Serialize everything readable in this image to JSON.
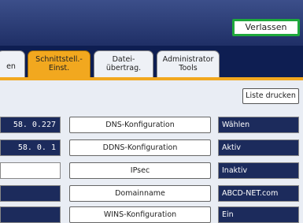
{
  "header": {
    "exit_label": "Verlassen"
  },
  "tabs": [
    {
      "line1": "en",
      "line2": ""
    },
    {
      "line1": "Schnittstell.-",
      "line2": "Einst."
    },
    {
      "line1": "Datei-",
      "line2": "übertrag."
    },
    {
      "line1": "Administrator",
      "line2": "Tools"
    }
  ],
  "toolbar": {
    "print_list_label": "Liste drucken"
  },
  "left_values": [
    "58. 0.227",
    "58. 0. 1",
    "",
    "",
    ""
  ],
  "settings": [
    {
      "label": "DNS-Konfiguration",
      "value": "Wählen"
    },
    {
      "label": "DDNS-Konfiguration",
      "value": "Aktiv"
    },
    {
      "label": "IPsec",
      "value": "Inaktiv"
    },
    {
      "label": "Domainname",
      "value": "ABCD-NET.com"
    },
    {
      "label": "WINS-Konfiguration",
      "value": "Ein"
    }
  ],
  "colors": {
    "header_bg": "#2b3c78",
    "tab_active": "#f2a81f",
    "value_bg": "#1c2b5c",
    "exit_border": "#1ea83c"
  }
}
